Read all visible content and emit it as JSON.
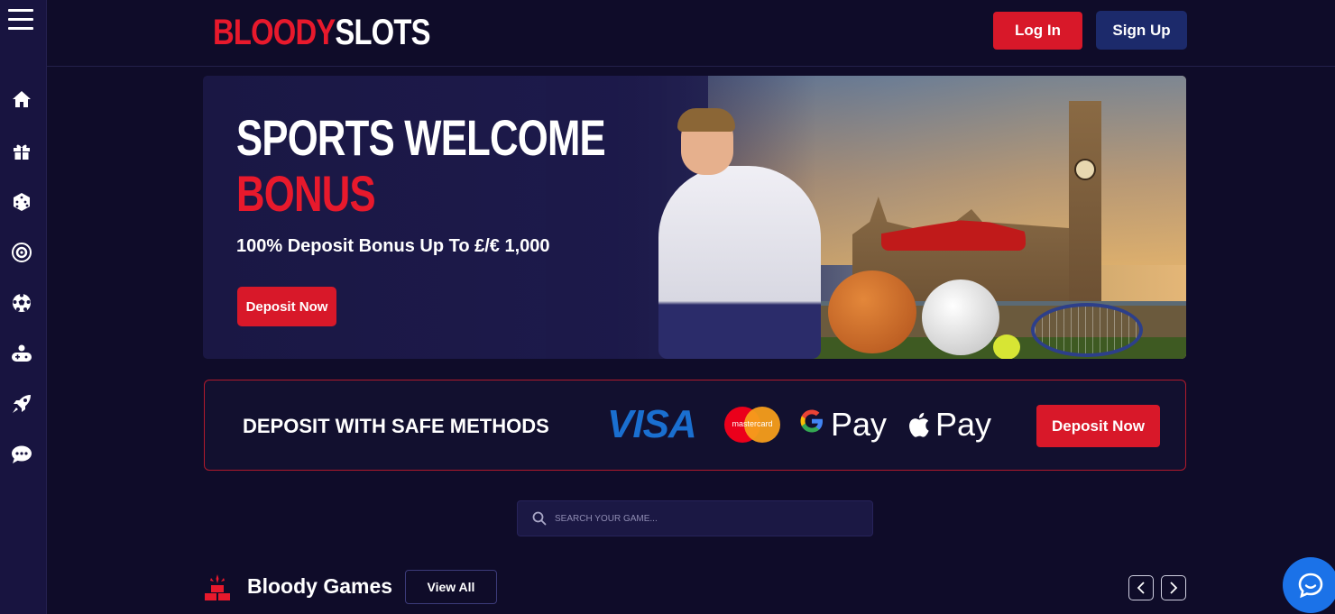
{
  "header": {
    "logo_bloody": "BLOODY",
    "logo_slots": "SLOTS",
    "login_label": "Log In",
    "signup_label": "Sign Up"
  },
  "sidebar": {
    "items": [
      {
        "icon": "home-icon"
      },
      {
        "icon": "gift-icon"
      },
      {
        "icon": "dice-icon"
      },
      {
        "icon": "roulette-icon"
      },
      {
        "icon": "soccer-ball-icon"
      },
      {
        "icon": "gamepad-icon"
      },
      {
        "icon": "rocket-icon"
      },
      {
        "icon": "chat-icon"
      }
    ]
  },
  "banner": {
    "title_line1": "SPORTS WELCOME",
    "title_line2": "BONUS",
    "subtitle": "100% Deposit Bonus Up To £/€ 1,000",
    "cta_label": "Deposit Now"
  },
  "payment": {
    "title": "DEPOSIT WITH SAFE METHODS",
    "visa": "VISA",
    "mastercard": "mastercard",
    "gpay": "Pay",
    "applepay": "Pay",
    "cta_label": "Deposit Now"
  },
  "search": {
    "placeholder": "SEARCH YOUR GAME..."
  },
  "games": {
    "title": "Bloody Games",
    "view_all_label": "View All"
  },
  "colors": {
    "background": "#0f0c29",
    "sidebar": "#181440",
    "accent_red": "#d81829",
    "signup_blue": "#1c2a6b",
    "chat_blue": "#1b72e8"
  }
}
